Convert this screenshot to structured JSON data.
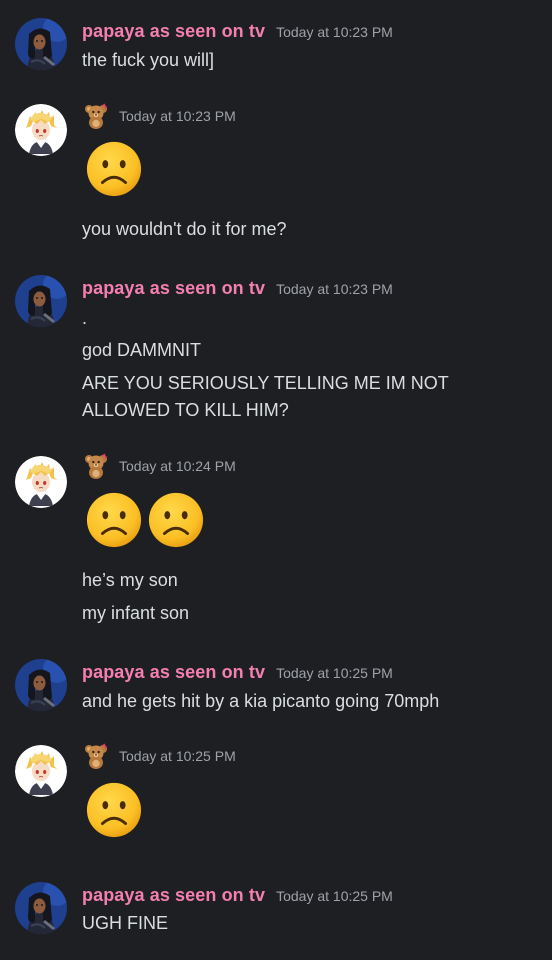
{
  "messages": [
    {
      "author": "papaya as seen on tv",
      "time": "Today at 10:23 PM",
      "lines": [
        "the fuck you will]"
      ]
    },
    {
      "author_badge": "teddy-bear-icon",
      "time": "Today at 10:23 PM",
      "emojis": [
        "frowning-face-emoji"
      ],
      "lines": [
        "you wouldn't do it for me?"
      ]
    },
    {
      "author": "papaya as seen on tv",
      "time": "Today at 10:23 PM",
      "lines": [
        ".",
        "god DAMMNIT",
        "ARE YOU SERIOUSLY TELLING ME IM NOT",
        "ALLOWED TO KILL HIM?"
      ]
    },
    {
      "author_badge": "teddy-bear-icon",
      "time": "Today at 10:24 PM",
      "emojis": [
        "frowning-face-emoji",
        "frowning-face-emoji"
      ],
      "lines": [
        "he’s my son",
        "my infant son"
      ]
    },
    {
      "author": "papaya as seen on tv",
      "time": "Today at 10:25 PM",
      "lines": [
        "and he gets hit by a kia picanto going 70mph"
      ]
    },
    {
      "author_badge": "teddy-bear-icon",
      "time": "Today at 10:25 PM",
      "emojis": [
        "frowning-face-emoji"
      ]
    },
    {
      "author": "papaya as seen on tv",
      "time": "Today at 10:25 PM",
      "lines": [
        "UGH FINE"
      ]
    }
  ],
  "colors": {
    "background": "#1e1f22",
    "username": "#f47fb0",
    "timestamp": "#9ea2a8",
    "text": "#dbdee1"
  }
}
